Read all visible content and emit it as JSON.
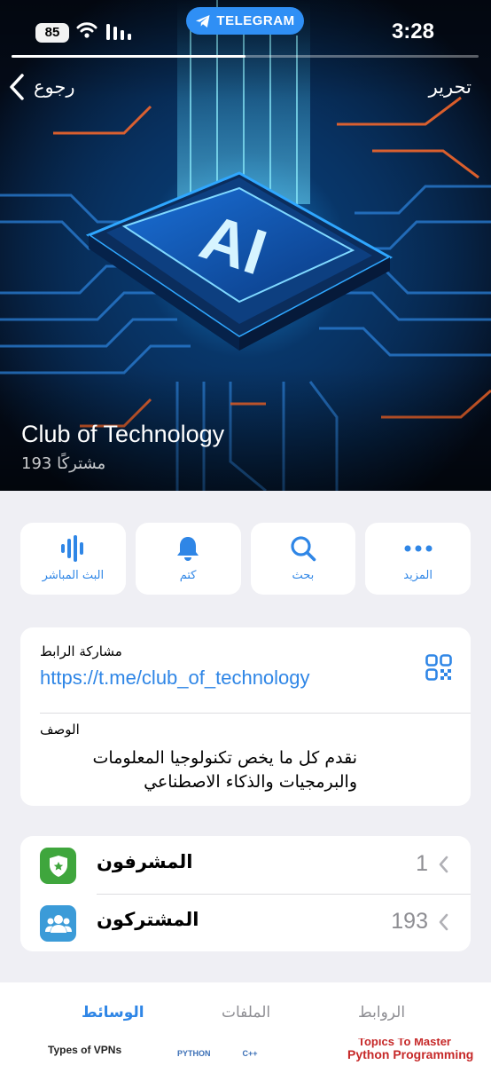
{
  "status": {
    "battery": "85",
    "pill_label": "TELEGRAM",
    "time": "3:28",
    "progress_fraction": 0.5
  },
  "nav": {
    "back_label": "رجوع",
    "edit_label": "تحرير"
  },
  "hero": {
    "image_text": "AI"
  },
  "channel": {
    "name": "Club of Technology",
    "subscribers": "193 مشتركًا"
  },
  "actions": [
    {
      "label": "البث المباشر",
      "icon": "live-stream-icon"
    },
    {
      "label": "كتم",
      "icon": "bell-icon"
    },
    {
      "label": "بحث",
      "icon": "search-icon"
    },
    {
      "label": "المزيد",
      "icon": "more-icon"
    }
  ],
  "info": {
    "link_label": "مشاركة الرابط",
    "link": "https://t.me/club_of_technology",
    "description_label": "الوصف",
    "description": "نقدم كل ما يخص تكنولوجيا المعلومات والبرمجيات والذكاء الاصطناعي"
  },
  "members": [
    {
      "label": "المشرفون",
      "count": "1",
      "icon": "admin-badge-icon",
      "color": "#3fa63d"
    },
    {
      "label": "المشتركون",
      "count": "193",
      "icon": "people-icon",
      "color": "#3b9bd8"
    }
  ],
  "tabs": [
    {
      "label": "الوسائط",
      "active": true
    },
    {
      "label": "الملفات",
      "active": false
    },
    {
      "label": "الروابط",
      "active": false
    }
  ],
  "strip": {
    "left_text": "Types of VPNs",
    "mid_left": "PYTHON",
    "mid_right": "C++",
    "right_top": "Topics To Master",
    "right_bottom": "Python Programming"
  },
  "colors": {
    "accent": "#2f86e6",
    "telegram_blue": "#2f8ff5",
    "background": "#efeff4"
  }
}
